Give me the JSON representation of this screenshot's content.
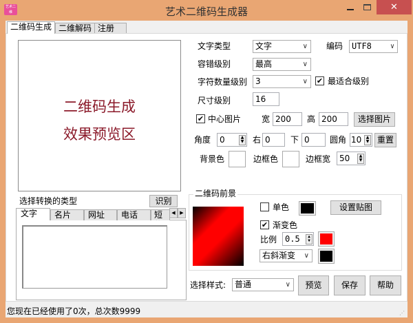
{
  "window": {
    "title": "艺术二维码生成器",
    "icon_text": "艺术二维"
  },
  "tabs": [
    "二维码生成",
    "二维解码",
    "注册"
  ],
  "preview": {
    "line1": "二维码生成",
    "line2": "效果预览区"
  },
  "convert": {
    "label": "选择转换的类型",
    "recognize_button": "识别",
    "tabs": [
      "文字",
      "名片",
      "网址",
      "电话",
      "短信"
    ],
    "text_value": ""
  },
  "settings": {
    "text_type_label": "文字类型",
    "text_type_value": "文字",
    "encoding_label": "编码",
    "encoding_value": "UTF8",
    "ecc_label": "容错级别",
    "ecc_value": "最高",
    "char_level_label": "字符数量级别",
    "char_level_value": "3",
    "best_fit_label": "最适合级别",
    "best_fit_checked": true,
    "size_label": "尺寸级别",
    "size_value": "16",
    "center_image_label": "中心图片",
    "center_image_checked": true,
    "width_label": "宽",
    "width_value": "200",
    "height_label": "高",
    "height_value": "200",
    "choose_image_button": "选择图片",
    "angle_label": "角度",
    "angle_value": "0",
    "right_label": "右",
    "right_value": "0",
    "down_label": "下",
    "down_value": "0",
    "corner_label": "圆角",
    "corner_value": "10",
    "reset_button": "重置",
    "bg_color_label": "背景色",
    "border_color_label": "边框色",
    "border_width_label": "边框宽",
    "border_width_value": "50"
  },
  "foreground": {
    "group_label": "二维码前景",
    "single_color_label": "单色",
    "single_color_checked": false,
    "single_color": "#000000",
    "set_texture_button": "设置贴图",
    "gradient_label": "渐变色",
    "gradient_checked": true,
    "ratio_label": "比例",
    "ratio_value": "0.5",
    "gradient_color1": "#ff0000",
    "gradient_type": "右斜渐变",
    "gradient_color2": "#000000"
  },
  "bottom": {
    "style_label": "选择样式:",
    "style_value": "普通",
    "preview_button": "预览",
    "save_button": "保存",
    "help_button": "帮助"
  },
  "status": "您现在已经使用了0次，总次数9999",
  "colors": {
    "frame": "#e9a673",
    "close": "#c75050",
    "preview_text": "#8b1a2a"
  }
}
